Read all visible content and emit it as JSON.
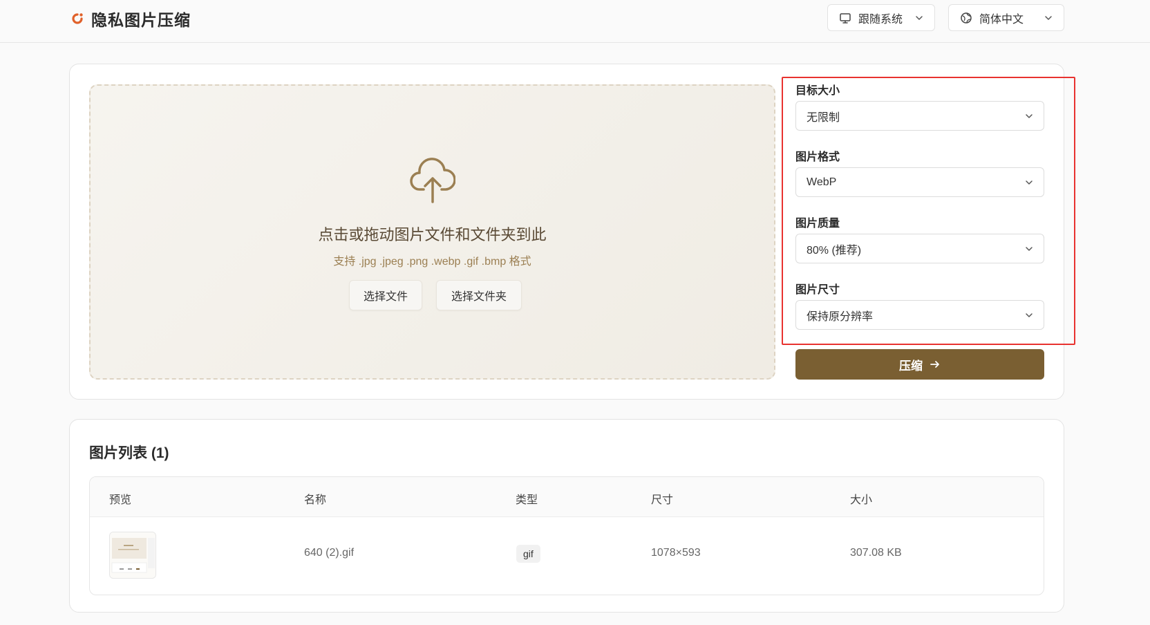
{
  "header": {
    "title": "隐私图片压缩",
    "system_select": "跟随系统",
    "language_select": "简体中文"
  },
  "dropzone": {
    "title": "点击或拖动图片文件和文件夹到此",
    "subtitle": "支持 .jpg .jpeg .png .webp .gif .bmp 格式",
    "select_file": "选择文件",
    "select_folder": "选择文件夹"
  },
  "settings": {
    "target_size": {
      "label": "目标大小",
      "value": "无限制"
    },
    "format": {
      "label": "图片格式",
      "value": "WebP"
    },
    "quality": {
      "label": "图片质量",
      "value": "80% (推荐)"
    },
    "dimension": {
      "label": "图片尺寸",
      "value": "保持原分辨率"
    },
    "compress_label": "压缩"
  },
  "image_list": {
    "title": "图片列表 (1)",
    "columns": [
      "预览",
      "名称",
      "类型",
      "尺寸",
      "大小"
    ],
    "rows": [
      {
        "name": "640 (2).gif",
        "type": "gif",
        "dimensions": "1078×593",
        "size": "307.08 KB"
      }
    ]
  },
  "colors": {
    "accent": "#7a5f32",
    "logo": "#e0612a",
    "highlight": "#e8322f"
  }
}
